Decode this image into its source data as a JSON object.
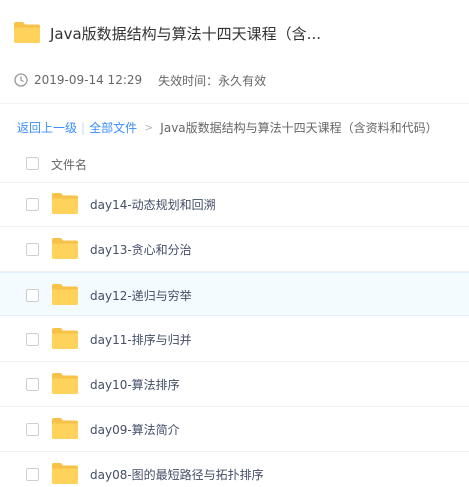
{
  "header": {
    "title": "Java版数据结构与算法十四天课程（含...",
    "folder_icon": "folder-icon"
  },
  "meta": {
    "icon": "clock-icon",
    "date": "2019-09-14 12:29",
    "expiry": "失效时间：永久有效"
  },
  "breadcrumb": {
    "back": "返回上一级",
    "separator": "|",
    "all_files": "全部文件",
    "arrow": ">",
    "current": "Java版数据结构与算法十四天课程（含资料和代码）"
  },
  "list": {
    "column_name": "文件名",
    "rows": [
      {
        "name": "day14-动态规划和回溯"
      },
      {
        "name": "day13-贪心和分治"
      },
      {
        "name": "day12-递归与穷举"
      },
      {
        "name": "day11-排序与归并"
      },
      {
        "name": "day10-算法排序"
      },
      {
        "name": "day09-算法简介"
      },
      {
        "name": "day08-图的最短路径与拓扑排序"
      }
    ]
  },
  "colors": {
    "link": "#3b8cff",
    "folder": "#ffd25c",
    "hover_row": "#f4fbff"
  }
}
